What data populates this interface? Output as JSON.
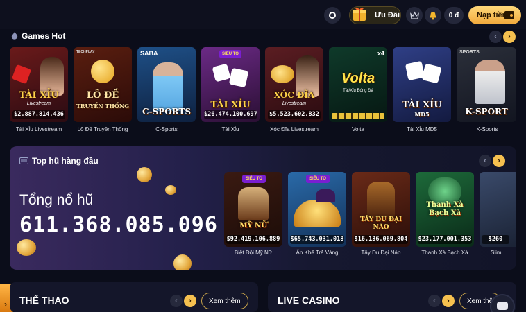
{
  "header": {
    "promo_label": "Ưu Đãi",
    "balance": "0 đ",
    "deposit_label": "Nạp tiền"
  },
  "games_hot": {
    "title": "Games Hot",
    "items": [
      {
        "label": "Tài Xỉu Livestream",
        "title": "TÀI XỈU",
        "subtitle": "Livestream",
        "jackpot": "$2.887.814.436"
      },
      {
        "label": "Lô Đề Truyền Thống",
        "title": "LÔ ĐỀ",
        "subtitle": "TRUYỀN THỐNG",
        "brand": "TECHPLAY"
      },
      {
        "label": "C-Sports",
        "title": "C-SPORTS",
        "brand": "SABA"
      },
      {
        "label": "Tài Xỉu",
        "title": "TÀI XỈU",
        "badge": "SIÊU TO",
        "jackpot": "$26.474.100.697"
      },
      {
        "label": "Xóc Đĩa Livestream",
        "title": "XÓC ĐĨA",
        "subtitle": "Livestream",
        "jackpot": "$5.523.602.832"
      },
      {
        "label": "Volta",
        "title": "Volta",
        "subtitle": "Tài/Xỉu Bóng Đá",
        "badge": "x4"
      },
      {
        "label": "Tài Xỉu MD5",
        "title": "TÀI XỈU",
        "subtitle": "MD5"
      },
      {
        "label": "K-Sports",
        "title": "K-SPORT",
        "brand": "SPORTS"
      }
    ]
  },
  "jackpots": {
    "title": "Top hũ hàng đầu",
    "total_label": "Tổng nổ hũ",
    "total_value": "611.368.085.096",
    "items": [
      {
        "label": "Biệt Đội Mỹ Nữ",
        "title": "MỸ NỮ",
        "badge": "SIÊU TO",
        "jackpot": "$92.419.106.889"
      },
      {
        "label": "Ăn Khế Trả Vàng",
        "title": "",
        "badge": "SIÊU TO",
        "jackpot": "$65.743.031.018"
      },
      {
        "label": "Tây Du Đại Náo",
        "title": "TÂY DU ĐẠI NÁO",
        "jackpot": "$16.136.069.804"
      },
      {
        "label": "Thanh Xà Bạch Xà",
        "title": "Thanh Xà Bạch Xà",
        "jackpot": "$23.177.001.353"
      },
      {
        "label": "Slim",
        "jackpot": "$260"
      }
    ]
  },
  "sports": {
    "title": "THỂ THAO",
    "more": "Xem thêm"
  },
  "casino": {
    "title": "LIVE CASINO",
    "more": "Xem thê"
  },
  "colors": {
    "accent": "#f5c04f",
    "bg": "#0b0d1a",
    "panel": "#14162a"
  }
}
